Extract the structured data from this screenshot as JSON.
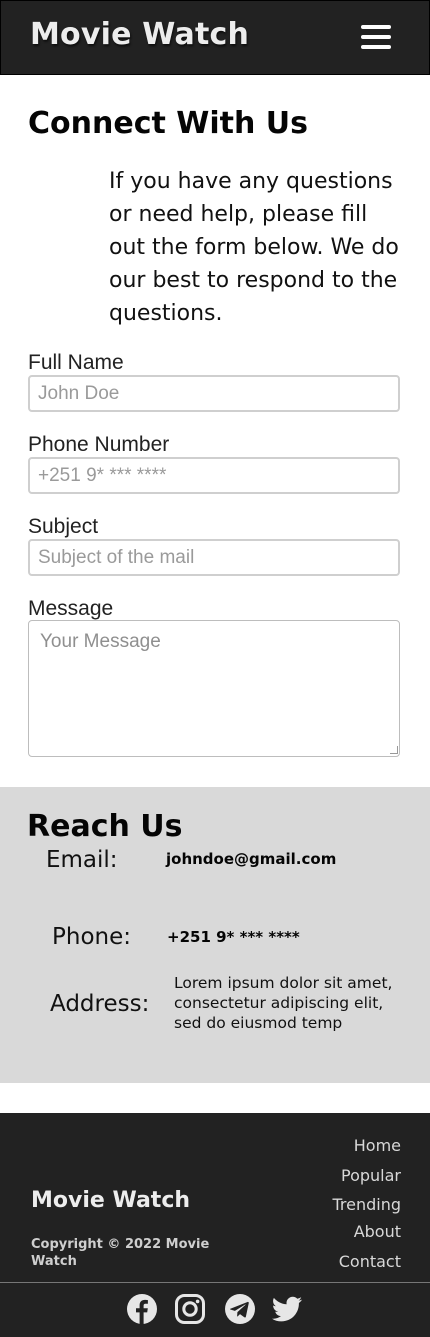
{
  "header": {
    "brand": "Movie Watch",
    "menu_icon": "hamburger-menu-icon"
  },
  "contact": {
    "title": "Connect With Us",
    "intro": "If you have any questions or need help, please fill out the form below. We do our best to respond to the questions."
  },
  "form": {
    "full_name": {
      "label": "Full Name",
      "placeholder": "John Doe"
    },
    "phone": {
      "label": "Phone Number",
      "placeholder": "+251 9* *** ****"
    },
    "subject": {
      "label": "Subject",
      "placeholder": "Subject of the mail"
    },
    "message": {
      "label": "Message",
      "placeholder": "Your Message"
    }
  },
  "reach": {
    "title": "Reach Us",
    "email_label": "Email:",
    "email_value": "johndoe@gmail.com",
    "phone_label": "Phone:",
    "phone_value": "+251 9* *** ****",
    "address_label": "Address:",
    "address_line1": "Lorem ipsum dolor sit amet,",
    "address_line2": "consectetur adipiscing elit, sed do eiusmod temp"
  },
  "footer": {
    "brand": "Movie Watch",
    "copyright": "Copyright © 2022 Movie Watch",
    "links": [
      "Home",
      "Popular",
      "Trending",
      "About",
      "Contact"
    ],
    "social": [
      "facebook-icon",
      "instagram-icon",
      "telegram-icon",
      "twitter-icon"
    ]
  },
  "colors": {
    "header_bg": "#222222",
    "reach_bg": "#d9d9d9",
    "footer_bg": "#222222"
  }
}
